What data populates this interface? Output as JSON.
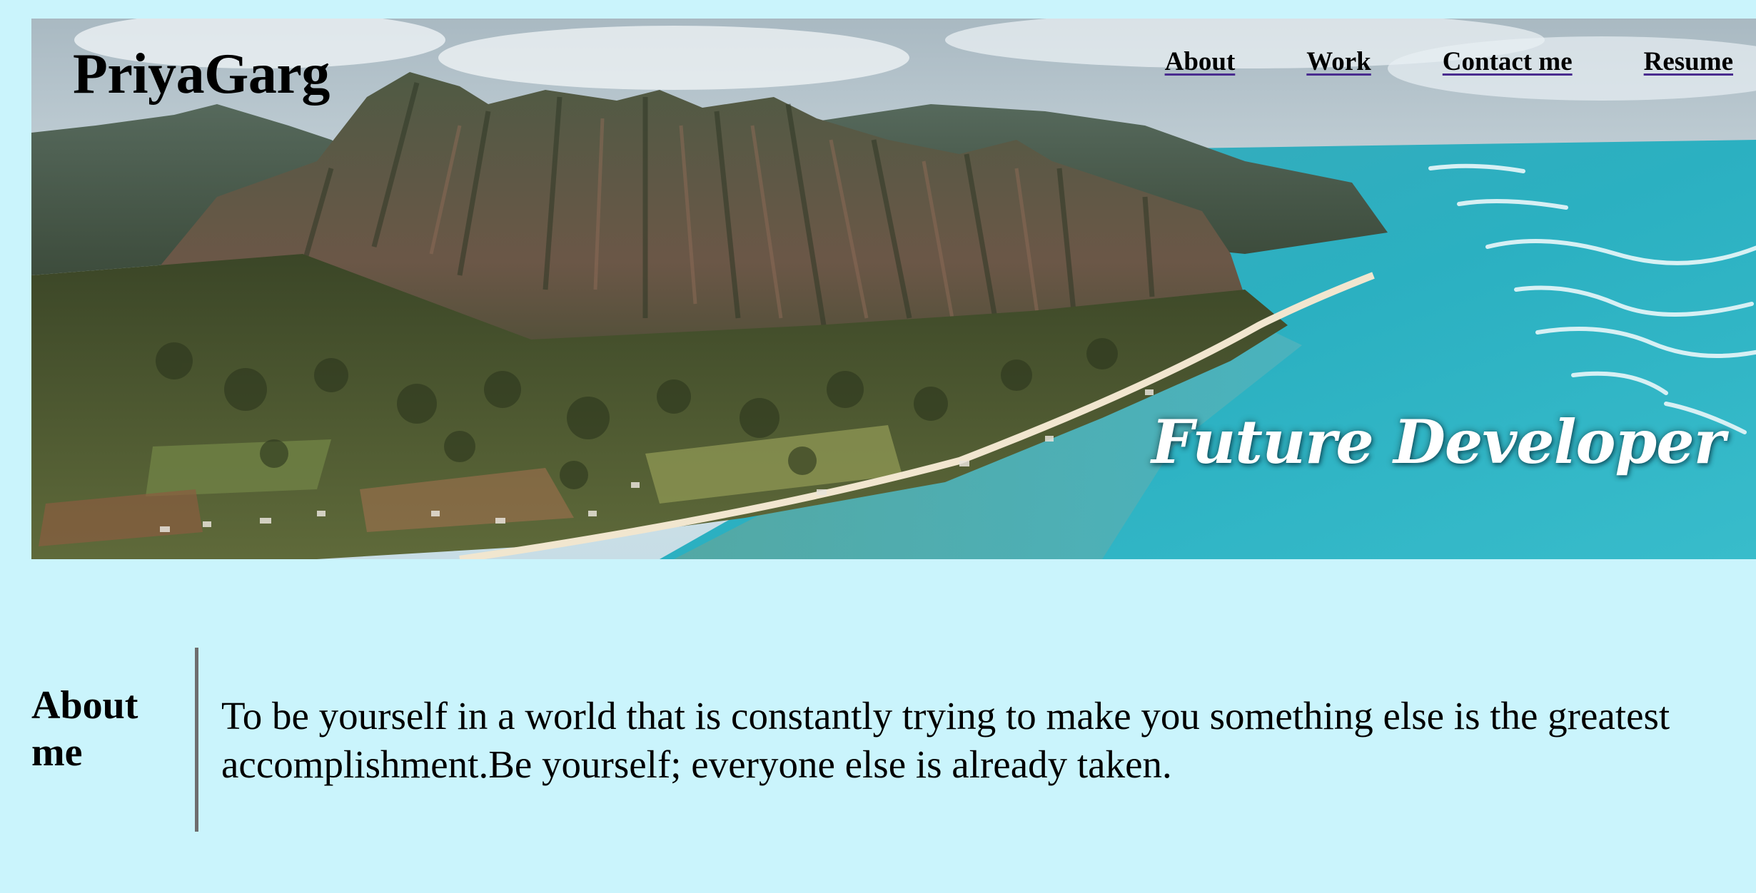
{
  "header": {
    "brand": "PriyaGarg",
    "nav": [
      {
        "label": "About"
      },
      {
        "label": "Work"
      },
      {
        "label": "Contact me"
      },
      {
        "label": "Resume"
      }
    ],
    "tagline": "Future Developer",
    "hero_image": "aerial-coastline-mountains-photo"
  },
  "about": {
    "heading": "About me",
    "text": "To be yourself in a world that is constantly trying to make you something else is the greatest accomplishment.Be yourself; everyone else is already taken."
  },
  "colors": {
    "page_background": "#caf4fc",
    "text": "#000000",
    "link_underline": "#4a2c8f",
    "divider": "#6e6e6e",
    "tagline": "#ffffff"
  }
}
